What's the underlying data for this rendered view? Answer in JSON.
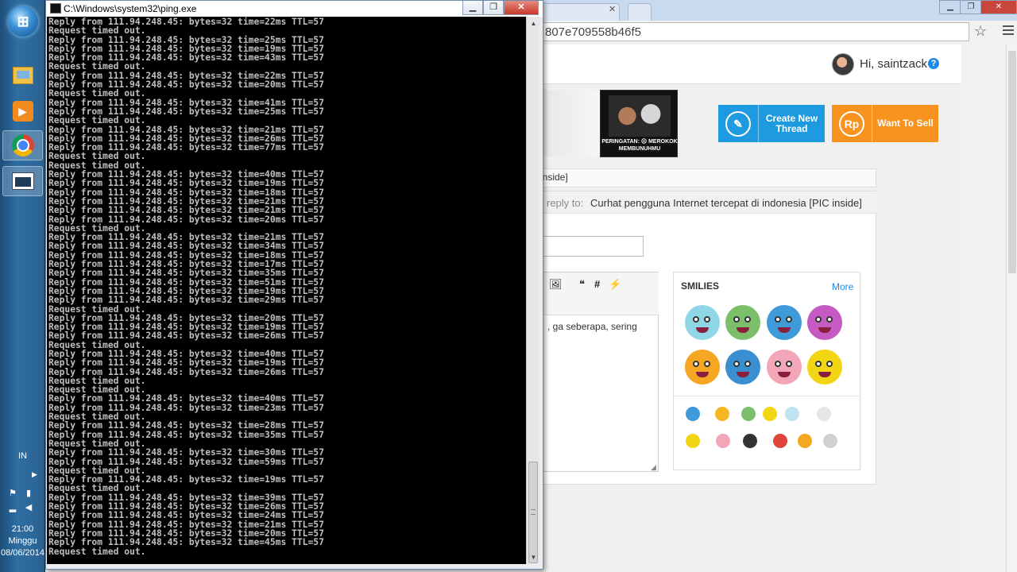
{
  "taskbar": {
    "language": "IN",
    "time": "21:00",
    "day": "Minggu",
    "date": "08/06/2014"
  },
  "cmd": {
    "title": "C:\\Windows\\system32\\ping.exe",
    "lines": [
      "Reply from 111.94.248.45: bytes=32 time=22ms TTL=57",
      "Request timed out.",
      "Reply from 111.94.248.45: bytes=32 time=25ms TTL=57",
      "Reply from 111.94.248.45: bytes=32 time=19ms TTL=57",
      "Reply from 111.94.248.45: bytes=32 time=43ms TTL=57",
      "Request timed out.",
      "Reply from 111.94.248.45: bytes=32 time=22ms TTL=57",
      "Reply from 111.94.248.45: bytes=32 time=20ms TTL=57",
      "Request timed out.",
      "Reply from 111.94.248.45: bytes=32 time=41ms TTL=57",
      "Reply from 111.94.248.45: bytes=32 time=25ms TTL=57",
      "Request timed out.",
      "Reply from 111.94.248.45: bytes=32 time=21ms TTL=57",
      "Reply from 111.94.248.45: bytes=32 time=26ms TTL=57",
      "Reply from 111.94.248.45: bytes=32 time=77ms TTL=57",
      "Request timed out.",
      "Request timed out.",
      "Reply from 111.94.248.45: bytes=32 time=40ms TTL=57",
      "Reply from 111.94.248.45: bytes=32 time=19ms TTL=57",
      "Reply from 111.94.248.45: bytes=32 time=18ms TTL=57",
      "Reply from 111.94.248.45: bytes=32 time=21ms TTL=57",
      "Reply from 111.94.248.45: bytes=32 time=21ms TTL=57",
      "Reply from 111.94.248.45: bytes=32 time=20ms TTL=57",
      "Request timed out.",
      "Reply from 111.94.248.45: bytes=32 time=21ms TTL=57",
      "Reply from 111.94.248.45: bytes=32 time=34ms TTL=57",
      "Reply from 111.94.248.45: bytes=32 time=18ms TTL=57",
      "Reply from 111.94.248.45: bytes=32 time=17ms TTL=57",
      "Reply from 111.94.248.45: bytes=32 time=35ms TTL=57",
      "Reply from 111.94.248.45: bytes=32 time=51ms TTL=57",
      "Reply from 111.94.248.45: bytes=32 time=19ms TTL=57",
      "Reply from 111.94.248.45: bytes=32 time=29ms TTL=57",
      "Request timed out.",
      "Reply from 111.94.248.45: bytes=32 time=20ms TTL=57",
      "Reply from 111.94.248.45: bytes=32 time=19ms TTL=57",
      "Reply from 111.94.248.45: bytes=32 time=26ms TTL=57",
      "Request timed out.",
      "Reply from 111.94.248.45: bytes=32 time=40ms TTL=57",
      "Reply from 111.94.248.45: bytes=32 time=19ms TTL=57",
      "Reply from 111.94.248.45: bytes=32 time=26ms TTL=57",
      "Request timed out.",
      "Request timed out.",
      "Reply from 111.94.248.45: bytes=32 time=40ms TTL=57",
      "Reply from 111.94.248.45: bytes=32 time=23ms TTL=57",
      "Request timed out.",
      "Reply from 111.94.248.45: bytes=32 time=28ms TTL=57",
      "Reply from 111.94.248.45: bytes=32 time=35ms TTL=57",
      "Request timed out.",
      "Reply from 111.94.248.45: bytes=32 time=30ms TTL=57",
      "Reply from 111.94.248.45: bytes=32 time=59ms TTL=57",
      "Request timed out.",
      "Reply from 111.94.248.45: bytes=32 time=19ms TTL=57",
      "Request timed out.",
      "Reply from 111.94.248.45: bytes=32 time=39ms TTL=57",
      "Reply from 111.94.248.45: bytes=32 time=26ms TTL=57",
      "Reply from 111.94.248.45: bytes=32 time=24ms TTL=57",
      "Reply from 111.94.248.45: bytes=32 time=21ms TTL=57",
      "Reply from 111.94.248.45: bytes=32 time=20ms TTL=57",
      "Reply from 111.94.248.45: bytes=32 time=45ms TTL=57",
      "Request timed out."
    ]
  },
  "browser": {
    "url": "807e709558b46f5",
    "greeting": "Hi, saintzack",
    "help": "?",
    "ad_warning": "PERINGATAN: ☹ MEROKOK MEMBUNUHMU",
    "create_thread_icon": "✎",
    "create_thread": "Create New Thread",
    "want_to_sell_icon": "Rp",
    "want_to_sell": "Want To Sell",
    "breadcrumb": "inside]",
    "reply_label": "reply to:",
    "reply_title": "Curhat pengguna Internet tercepat di indonesia [PIC inside]",
    "editor_text": ", ga seberapa, sering",
    "smilies_title": "SMILIES",
    "smilies_more": "More"
  },
  "colors": {
    "create_thread": "#1e9ae0",
    "want_to_sell": "#f7931e",
    "link": "#1e88e5"
  }
}
